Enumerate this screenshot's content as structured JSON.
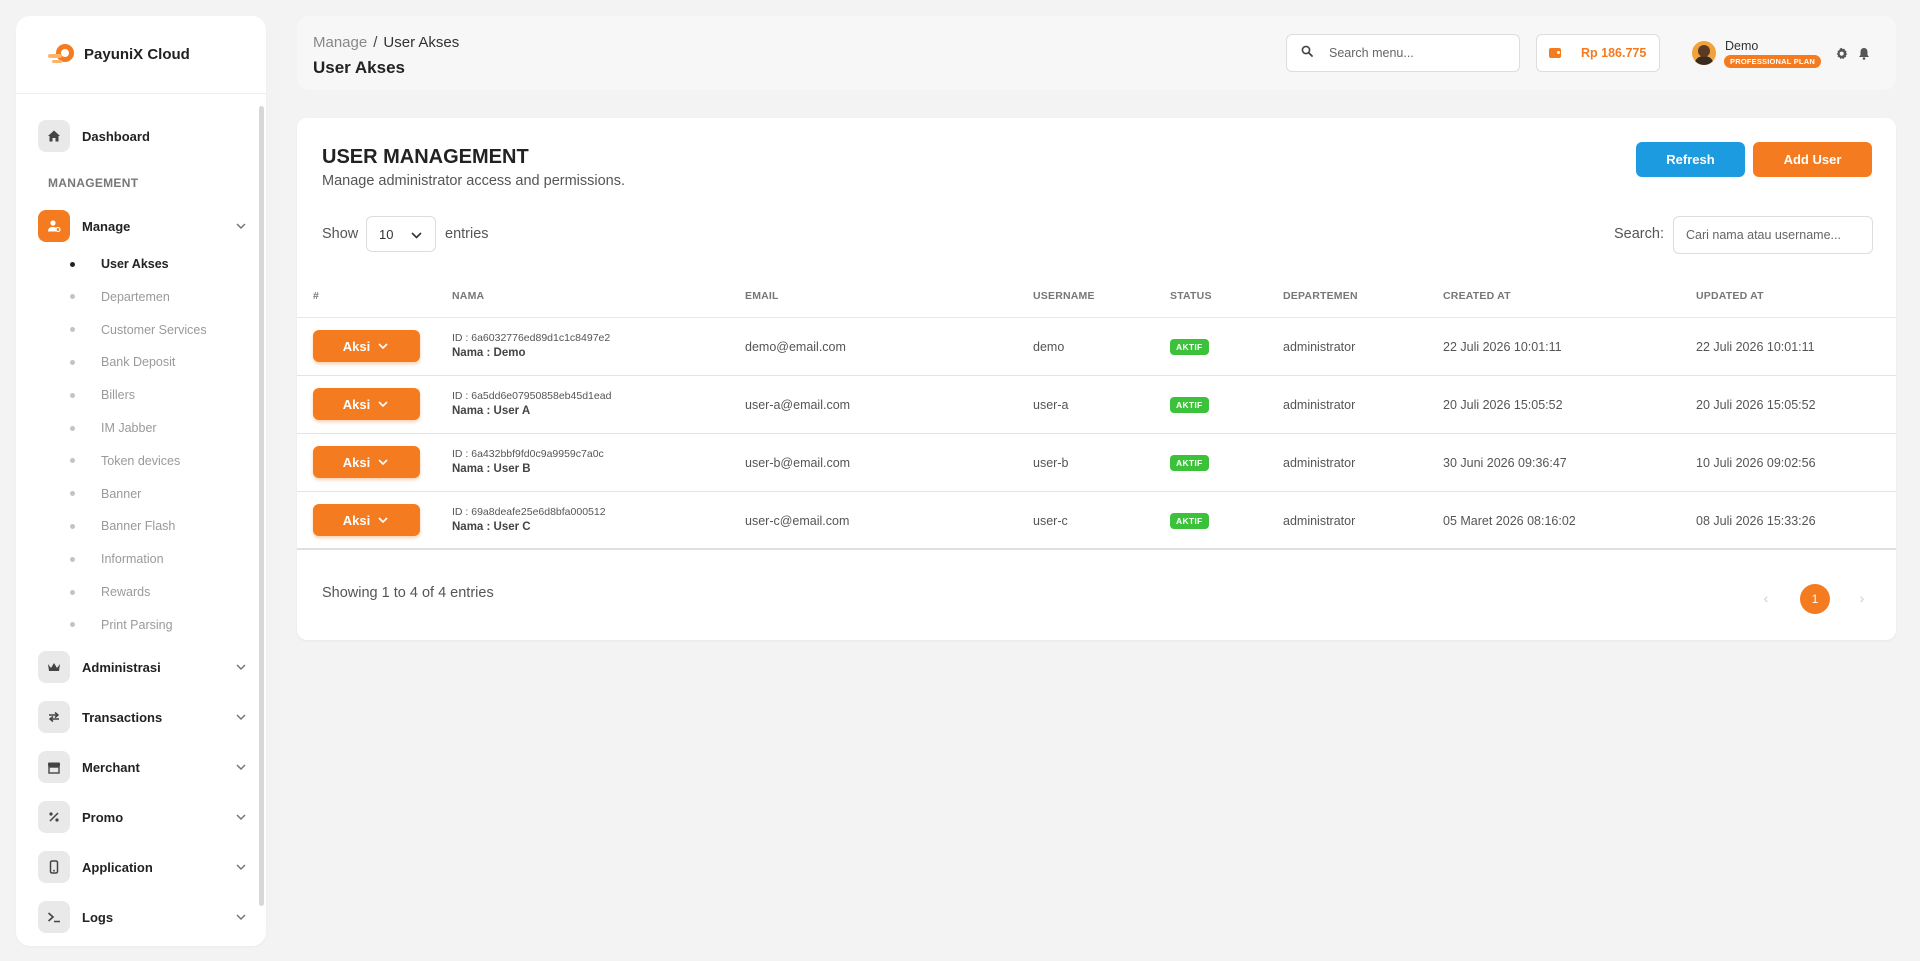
{
  "brand": {
    "name": "PayuniX Cloud"
  },
  "sidebar": {
    "dashboard_label": "Dashboard",
    "section_label": "MANAGEMENT",
    "manage_label": "Manage",
    "sub_items": [
      {
        "label": "User Akses",
        "active": true
      },
      {
        "label": "Departemen"
      },
      {
        "label": "Customer Services"
      },
      {
        "label": "Bank Deposit"
      },
      {
        "label": "Billers"
      },
      {
        "label": "IM Jabber"
      },
      {
        "label": "Token devices"
      },
      {
        "label": "Banner"
      },
      {
        "label": "Banner Flash"
      },
      {
        "label": "Information"
      },
      {
        "label": "Rewards"
      },
      {
        "label": "Print Parsing"
      }
    ],
    "groups": [
      {
        "label": "Administrasi",
        "icon": "crown-icon"
      },
      {
        "label": "Transactions",
        "icon": "swap-icon"
      },
      {
        "label": "Merchant",
        "icon": "store-icon"
      },
      {
        "label": "Promo",
        "icon": "percent-icon"
      },
      {
        "label": "Application",
        "icon": "mobile-icon"
      },
      {
        "label": "Logs",
        "icon": "terminal-icon"
      }
    ]
  },
  "header": {
    "breadcrumb_parent": "Manage",
    "breadcrumb_sep": "/",
    "breadcrumb_current": "User Akses",
    "title": "User Akses",
    "search_placeholder": "Search menu...",
    "balance": "Rp 186.775",
    "user_name": "Demo",
    "plan": "PROFESSIONAL PLAN"
  },
  "card": {
    "title": "USER MANAGEMENT",
    "subtitle": "Manage administrator access and permissions.",
    "refresh_label": "Refresh",
    "add_label": "Add User",
    "show_label": "Show",
    "page_size": "10",
    "entries_label": "entries",
    "search_label": "Search:",
    "search_placeholder": "Cari nama atau username..."
  },
  "table": {
    "columns": [
      "#",
      "NAMA",
      "EMAIL",
      "USERNAME",
      "STATUS",
      "DEPARTEMEN",
      "CREATED AT",
      "UPDATED AT"
    ],
    "action_label": "Aksi",
    "rows": [
      {
        "id": "ID : 6a6032776ed89d1c1c8497e2",
        "nama": "Nama : Demo",
        "email": "demo@email.com",
        "username": "demo",
        "status": "AKTIF",
        "departemen": "administrator",
        "created": "22 Juli 2026 10:01:11",
        "updated": "22 Juli 2026 10:01:11"
      },
      {
        "id": "ID : 6a5dd6e07950858eb45d1ead",
        "nama": "Nama : User A",
        "email": "user-a@email.com",
        "username": "user-a",
        "status": "AKTIF",
        "departemen": "administrator",
        "created": "20 Juli 2026 15:05:52",
        "updated": "20 Juli 2026 15:05:52"
      },
      {
        "id": "ID : 6a432bbf9fd0c9a9959c7a0c",
        "nama": "Nama : User B",
        "email": "user-b@email.com",
        "username": "user-b",
        "status": "AKTIF",
        "departemen": "administrator",
        "created": "30 Juni 2026 09:36:47",
        "updated": "10 Juli 2026 09:02:56"
      },
      {
        "id": "ID : 69a8deafe25e6d8bfa000512",
        "nama": "Nama : User C",
        "email": "user-c@email.com",
        "username": "user-c",
        "status": "AKTIF",
        "departemen": "administrator",
        "created": "05 Maret 2026 08:16:02",
        "updated": "08 Juli 2026 15:33:26"
      }
    ]
  },
  "footer": {
    "info": "Showing 1 to 4 of 4 entries",
    "current_page": "1"
  },
  "colors": {
    "accent": "#f47b20",
    "info": "#1d9be0",
    "success": "#3cc13b"
  }
}
